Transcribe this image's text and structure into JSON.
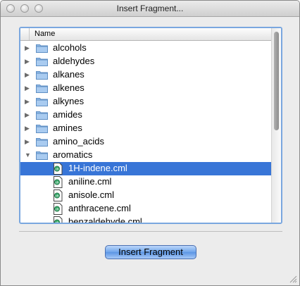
{
  "window": {
    "title": "Insert Fragment..."
  },
  "tree": {
    "header": "Name",
    "rows": [
      {
        "label": "alcohols",
        "kind": "folder",
        "expanded": false,
        "selected": false
      },
      {
        "label": "aldehydes",
        "kind": "folder",
        "expanded": false,
        "selected": false
      },
      {
        "label": "alkanes",
        "kind": "folder",
        "expanded": false,
        "selected": false
      },
      {
        "label": "alkenes",
        "kind": "folder",
        "expanded": false,
        "selected": false
      },
      {
        "label": "alkynes",
        "kind": "folder",
        "expanded": false,
        "selected": false
      },
      {
        "label": "amides",
        "kind": "folder",
        "expanded": false,
        "selected": false
      },
      {
        "label": "amines",
        "kind": "folder",
        "expanded": false,
        "selected": false
      },
      {
        "label": "amino_acids",
        "kind": "folder",
        "expanded": false,
        "selected": false
      },
      {
        "label": "aromatics",
        "kind": "folder",
        "expanded": true,
        "selected": false
      },
      {
        "label": "1H-indene.cml",
        "kind": "file",
        "selected": true
      },
      {
        "label": "aniline.cml",
        "kind": "file",
        "selected": false
      },
      {
        "label": "anisole.cml",
        "kind": "file",
        "selected": false
      },
      {
        "label": "anthracene.cml",
        "kind": "file",
        "selected": false
      },
      {
        "label": "benzaldehyde.cml",
        "kind": "file",
        "selected": false
      }
    ]
  },
  "insert_button": {
    "label": "Insert Fragment"
  },
  "icons": {
    "folder": "folder-icon",
    "file": "cml-file-icon",
    "collapsed": "triangle-right-icon",
    "expanded": "triangle-down-icon"
  },
  "colors": {
    "selection": "#3875d7",
    "folder": "#8fb9e6",
    "focus_ring": "#7aa7df"
  }
}
